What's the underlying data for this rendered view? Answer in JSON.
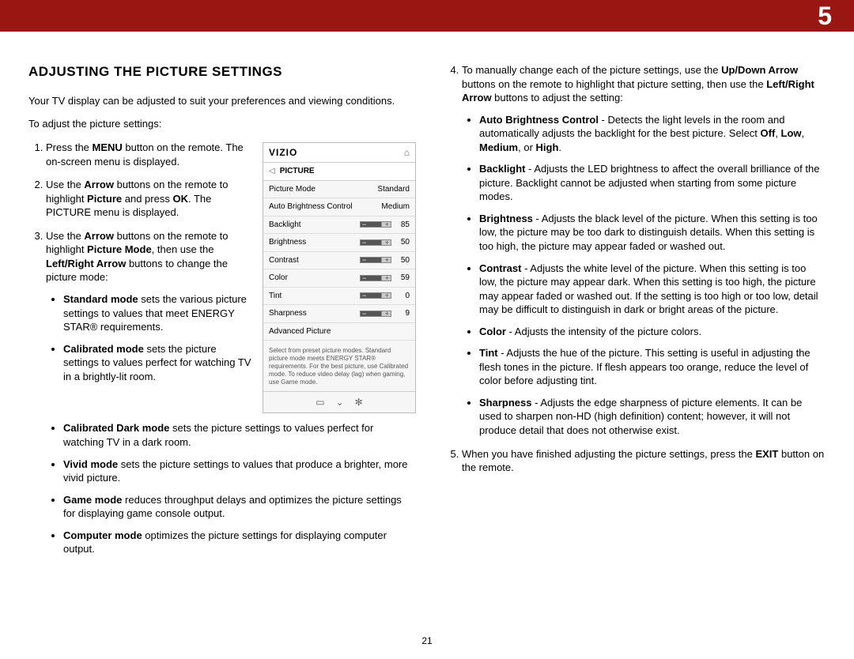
{
  "chapter": "5",
  "page_number": "21",
  "heading": "ADJUSTING THE PICTURE SETTINGS",
  "intro": "Your TV display can be adjusted to suit your preferences and viewing conditions.",
  "lead": "To adjust the picture settings:",
  "steps_col1": {
    "s1": {
      "pre": "Press the ",
      "b1": "MENU",
      "post": " button on the remote. The on-screen menu is displayed."
    },
    "s2": {
      "pre": "Use the ",
      "b1": "Arrow",
      "mid1": " buttons on the remote to highlight ",
      "b2": "Picture",
      "mid2": " and press ",
      "b3": "OK",
      "post": ". The PICTURE menu is displayed."
    },
    "s3": {
      "pre": "Use the ",
      "b1": "Arrow",
      "mid1": " buttons on the remote to highlight ",
      "b2": "Picture Mode",
      "mid2": ", then use the ",
      "b3": "Left/Right Arrow",
      "post": " buttons to change the picture mode:"
    },
    "modes": {
      "std": {
        "b": "Standard mode",
        "t": " sets the various picture settings to values that meet ENERGY STAR® requirements."
      },
      "cal": {
        "b": "Calibrated mode",
        "t": " sets the picture settings to values perfect for watching TV in a brightly-lit room."
      },
      "caldark": {
        "b": "Calibrated Dark mode",
        "t": " sets the picture settings to values perfect for watching TV in a dark room."
      },
      "vivid": {
        "b": "Vivid mode",
        "t": " sets the picture settings to values that produce a brighter, more vivid picture."
      },
      "game": {
        "b": "Game mode",
        "t": " reduces throughput delays and optimizes the picture settings for displaying game console output."
      },
      "comp": {
        "b": "Computer mode",
        "t": " optimizes the picture settings for displaying computer output."
      }
    }
  },
  "steps_col2": {
    "s4": {
      "pre": "To manually change each of the picture settings, use the ",
      "b1": "Up/Down Arrow",
      "mid1": " buttons on the remote to highlight that picture setting, then use the ",
      "b2": "Left/Right Arrow",
      "post": " buttons to adjust the setting:"
    },
    "opts": {
      "abc": {
        "b": "Auto Brightness Control",
        "t": " - Detects the light levels in the room and automatically adjusts the backlight for the best picture. Select ",
        "b2": "Off",
        "c1": ", ",
        "b3": "Low",
        "c2": ", ",
        "b4": "Medium",
        "c3": ", or ",
        "b5": "High",
        "c4": "."
      },
      "back": {
        "b": "Backlight",
        "t": " - Adjusts the LED brightness to affect the overall brilliance of the picture. Backlight cannot be adjusted when starting from some picture modes."
      },
      "bright": {
        "b": "Brightness",
        "t": " - Adjusts the black level of the picture. When this setting is too low, the picture may be too dark to distinguish details. When this setting is too high, the picture may appear faded or washed out."
      },
      "contrast": {
        "b": "Contrast",
        "t": " - Adjusts the white level of the picture. When this setting is too low, the picture may appear dark. When this setting is too high, the picture may appear faded or washed out. If the setting is too high or too low, detail may be difficult to distinguish in dark or bright areas of the picture."
      },
      "color": {
        "b": "Color",
        "t": " - Adjusts the intensity of the picture colors."
      },
      "tint": {
        "b": "Tint",
        "t": " - Adjusts the hue of the picture. This setting is useful in adjusting the flesh tones in the picture. If flesh appears too orange, reduce the level of color before adjusting tint."
      },
      "sharp": {
        "b": "Sharpness",
        "t": " - Adjusts the edge sharpness of picture elements. It can be used to sharpen non-HD (high definition) content; however, it will not produce detail that does not otherwise exist."
      }
    },
    "s5": {
      "pre": "When you have finished adjusting the picture settings, press the ",
      "b1": "EXIT",
      "post": " button on the remote."
    }
  },
  "menu": {
    "brand": "VIZIO",
    "title": "PICTURE",
    "rows": {
      "pm": {
        "label": "Picture Mode",
        "value": "Standard"
      },
      "abc": {
        "label": "Auto Brightness Control",
        "value": "Medium"
      },
      "bl": {
        "label": "Backlight",
        "value": "85"
      },
      "br": {
        "label": "Brightness",
        "value": "50"
      },
      "co": {
        "label": "Contrast",
        "value": "50"
      },
      "cl": {
        "label": "Color",
        "value": "59"
      },
      "ti": {
        "label": "Tint",
        "value": "0"
      },
      "sh": {
        "label": "Sharpness",
        "value": "9"
      },
      "adv": {
        "label": "Advanced Picture"
      }
    },
    "help": "Select from preset picture modes. Standard picture mode meets ENERGY STAR® requirements. For the best picture, use Calibrated mode. To reduce video delay (lag) when gaming, use Game mode."
  }
}
